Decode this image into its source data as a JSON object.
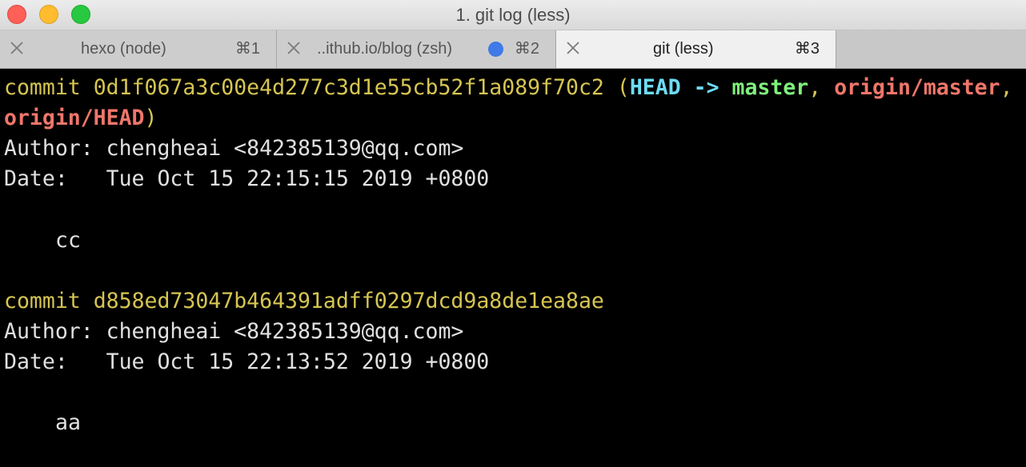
{
  "window": {
    "title": "1. git log (less)",
    "traffic_lights": [
      "close",
      "minimize",
      "zoom"
    ]
  },
  "tabs": [
    {
      "label": "hexo (node)",
      "shortcut": "⌘1",
      "active": false
    },
    {
      "label": "..ithub.io/blog (zsh)",
      "shortcut": "⌘2",
      "active": false,
      "activity_dot_color": "#3f7ae6"
    },
    {
      "label": "git (less)",
      "shortcut": "⌘3",
      "active": true
    }
  ],
  "terminal": {
    "commits": [
      {
        "keyword": "commit",
        "hash": "0d1f067a3c00e4d277c3d1e55cb52f1a089f70c2",
        "refs": {
          "open": "(",
          "head": "HEAD",
          "arrow": "->",
          "branch": "master",
          "sep1": ",",
          "remote": "origin/master",
          "sep2": ",",
          "remote_head": "origin/HEAD",
          "close": ")"
        },
        "author": "Author: chengheai <842385139@qq.com>",
        "date": "Date:   Tue Oct 15 22:15:15 2019 +0800",
        "message": "cc"
      },
      {
        "keyword": "commit",
        "hash": "d858ed73047b464391adff0297dcd9a8de1ea8ae",
        "author": "Author: chengheai <842385139@qq.com>",
        "date": "Date:   Tue Oct 15 22:13:52 2019 +0800",
        "message": "aa"
      }
    ],
    "colors": {
      "commit_yellow": "#d6c552",
      "head_cyan": "#6ddcf5",
      "branch_green": "#7ff07c",
      "remote_red": "#f0766b",
      "text": "#e0e0e0",
      "background": "#000000"
    }
  }
}
